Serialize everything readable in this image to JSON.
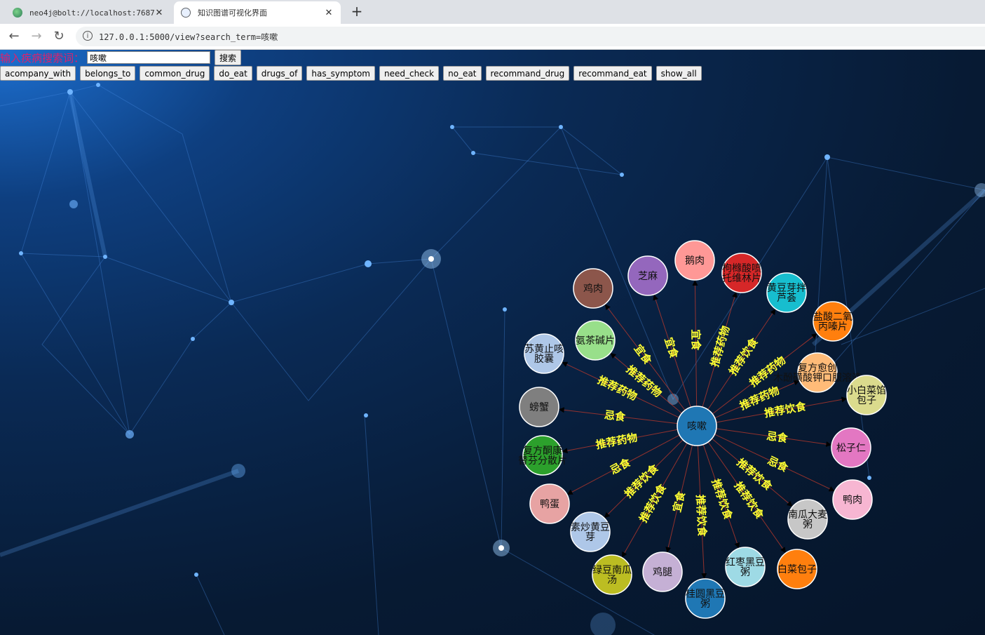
{
  "browser": {
    "tabs": [
      {
        "title": "neo4j@bolt://localhost:7687 -",
        "active": false
      },
      {
        "title": "知识图谱可视化界面",
        "active": true
      }
    ],
    "url": "127.0.0.1:5000/view?search_term=咳嗽"
  },
  "search": {
    "label": "输入疾病搜索词：",
    "value": "咳嗽",
    "button": "搜索"
  },
  "relations": [
    "acompany_with",
    "belongs_to",
    "common_drug",
    "do_eat",
    "drugs_of",
    "has_symptom",
    "need_check",
    "no_eat",
    "recommand_drug",
    "recommand_eat",
    "show_all"
  ],
  "graph": {
    "center": {
      "label": "咳嗽",
      "color": "#1f77b4"
    },
    "nodes": [
      {
        "lines": [
          "鸡肉"
        ],
        "color": "#8c564b",
        "edge": "宜食"
      },
      {
        "lines": [
          "芝麻"
        ],
        "color": "#9467bd",
        "edge": "宜食"
      },
      {
        "lines": [
          "鹅肉"
        ],
        "color": "#ff9896",
        "edge": "宜食"
      },
      {
        "lines": [
          "枸橼酸喷",
          "托维林片"
        ],
        "color": "#d62728",
        "edge": "推荐药物"
      },
      {
        "lines": [
          "黄豆芽拌",
          "芦荟"
        ],
        "color": "#17becf",
        "edge": "推荐饮食"
      },
      {
        "lines": [
          "盐酸二氧",
          "丙嗪片"
        ],
        "color": "#ff7f0e",
        "edge": "推荐药物"
      },
      {
        "lines": [
          "复方愈创",
          "木酚磺酸钾口服溶液"
        ],
        "color": "#ffbb78",
        "edge": "推荐药物"
      },
      {
        "lines": [
          "小白菜馅",
          "包子"
        ],
        "color": "#dbdb8d",
        "edge": "推荐饮食"
      },
      {
        "lines": [
          "松子仁"
        ],
        "color": "#e377c2",
        "edge": "忌食"
      },
      {
        "lines": [
          "鸭肉"
        ],
        "color": "#f7b6d2",
        "edge": "忌食"
      },
      {
        "lines": [
          "南瓜大麦",
          "粥"
        ],
        "color": "#c7c7c7",
        "edge": "推荐饮食"
      },
      {
        "lines": [
          "白菜包子"
        ],
        "color": "#ff7f0e",
        "edge": "推荐饮食"
      },
      {
        "lines": [
          "红枣黑豆",
          "粥"
        ],
        "color": "#9edae5",
        "edge": "推荐饮食"
      },
      {
        "lines": [
          "桂圆黑豆",
          "粥"
        ],
        "color": "#1f77b4",
        "edge": "推荐饮食"
      },
      {
        "lines": [
          "鸡腿"
        ],
        "color": "#c5b0d5",
        "edge": "宜食"
      },
      {
        "lines": [
          "绿豆南瓜",
          "汤"
        ],
        "color": "#bcbd22",
        "edge": "推荐饮食"
      },
      {
        "lines": [
          "素炒黄豆",
          "芽"
        ],
        "color": "#aec7e8",
        "edge": "推荐饮食"
      },
      {
        "lines": [
          "鸭蛋"
        ],
        "color": "#e7a3a3",
        "edge": "忌食"
      },
      {
        "lines": [
          "复方酮康",
          "替芬分散片"
        ],
        "color": "#2ca02c",
        "edge": "推荐药物"
      },
      {
        "lines": [
          "螃蟹"
        ],
        "color": "#7f7f7f",
        "edge": "忌食"
      },
      {
        "lines": [
          "苏黄止咳",
          "胶囊"
        ],
        "color": "#aec7e8",
        "edge": "推荐药物"
      },
      {
        "lines": [
          "氨茶碱片"
        ],
        "color": "#98df8a",
        "edge": "推荐药物"
      }
    ]
  }
}
